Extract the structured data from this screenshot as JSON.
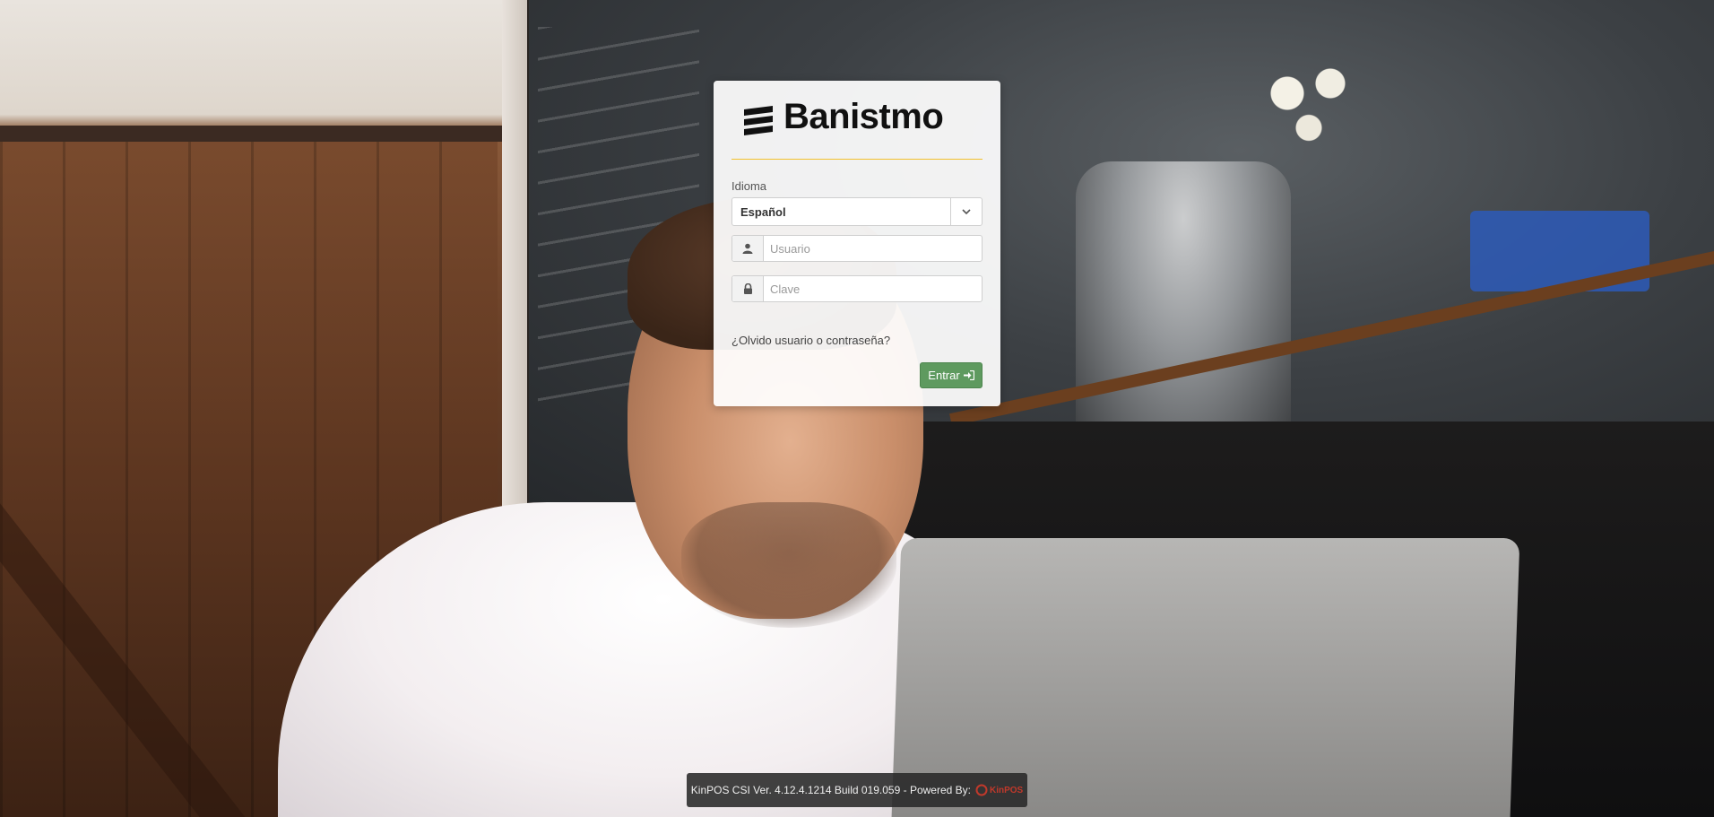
{
  "brand": {
    "name": "Banistmo"
  },
  "form": {
    "language_label": "Idioma",
    "language_value": "Español",
    "username_placeholder": "Usuario",
    "password_placeholder": "Clave",
    "forgot_link": "¿Olvido usuario o contraseña?",
    "submit_label": "Entrar"
  },
  "footer": {
    "version_text": "KinPOS CSI Ver. 4.12.4.1214 Build 019.059 - Powered By:",
    "powered_logo": "KinPOS"
  },
  "icons": [
    "chevron-down-icon",
    "user-icon",
    "lock-icon",
    "sign-in-icon"
  ],
  "colors": {
    "accent_rule": "#f2c12e",
    "submit_button": "#5e9a5f"
  }
}
